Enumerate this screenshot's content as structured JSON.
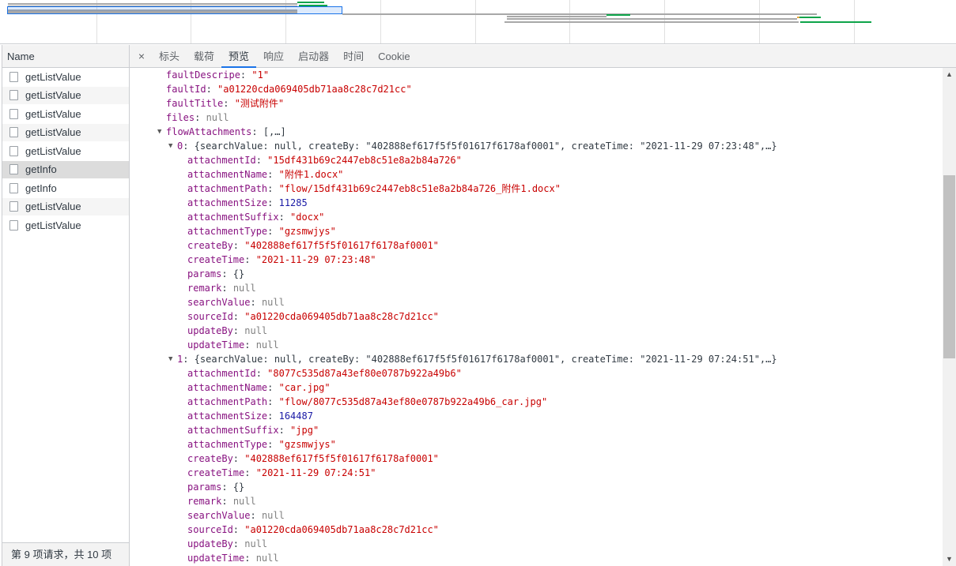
{
  "requests": {
    "header": "Name",
    "items": [
      {
        "name": "getListValue"
      },
      {
        "name": "getListValue"
      },
      {
        "name": "getListValue"
      },
      {
        "name": "getListValue"
      },
      {
        "name": "getListValue"
      },
      {
        "name": "getInfo"
      },
      {
        "name": "getInfo"
      },
      {
        "name": "getListValue"
      },
      {
        "name": "getListValue"
      }
    ],
    "selected_index": 5,
    "status": "第 9 项请求，共 10 项"
  },
  "detail_tabs": {
    "close": "×",
    "tabs": [
      "标头",
      "载荷",
      "预览",
      "响应",
      "启动器",
      "时间",
      "Cookie"
    ],
    "active": "预览"
  },
  "preview": {
    "lines": [
      {
        "indent": 210,
        "arrow": "",
        "parts": [
          [
            "key",
            "faultDescripe"
          ],
          [
            "pun",
            ": "
          ],
          [
            "str",
            "\"1\""
          ]
        ]
      },
      {
        "indent": 210,
        "arrow": "",
        "parts": [
          [
            "key",
            "faultId"
          ],
          [
            "pun",
            ": "
          ],
          [
            "str",
            "\"a01220cda069405db71aa8c28c7d21cc\""
          ]
        ]
      },
      {
        "indent": 210,
        "arrow": "",
        "parts": [
          [
            "key",
            "faultTitle"
          ],
          [
            "pun",
            ": "
          ],
          [
            "str",
            "\"测试附件\""
          ]
        ]
      },
      {
        "indent": 210,
        "arrow": "",
        "parts": [
          [
            "key",
            "files"
          ],
          [
            "pun",
            ": "
          ],
          [
            "nul",
            "null"
          ]
        ]
      },
      {
        "indent": 210,
        "arrow": "▼",
        "parts": [
          [
            "key",
            "flowAttachments"
          ],
          [
            "pun",
            ": [,…]"
          ]
        ]
      },
      {
        "indent": 224,
        "arrow": "▼",
        "parts": [
          [
            "key",
            "0"
          ],
          [
            "pun",
            ": {searchValue: null, createBy: \"402888ef617f5f5f01617f6178af0001\", createTime: \"2021-11-29 07:23:48\",…}"
          ]
        ]
      },
      {
        "indent": 237,
        "arrow": "",
        "parts": [
          [
            "key",
            "attachmentId"
          ],
          [
            "pun",
            ": "
          ],
          [
            "str",
            "\"15df431b69c2447eb8c51e8a2b84a726\""
          ]
        ]
      },
      {
        "indent": 237,
        "arrow": "",
        "parts": [
          [
            "key",
            "attachmentName"
          ],
          [
            "pun",
            ": "
          ],
          [
            "str",
            "\"附件1.docx\""
          ]
        ]
      },
      {
        "indent": 237,
        "arrow": "",
        "parts": [
          [
            "key",
            "attachmentPath"
          ],
          [
            "pun",
            ": "
          ],
          [
            "str",
            "\"flow/15df431b69c2447eb8c51e8a2b84a726_附件1.docx\""
          ]
        ]
      },
      {
        "indent": 237,
        "arrow": "",
        "parts": [
          [
            "key",
            "attachmentSize"
          ],
          [
            "pun",
            ": "
          ],
          [
            "num",
            "11285"
          ]
        ]
      },
      {
        "indent": 237,
        "arrow": "",
        "parts": [
          [
            "key",
            "attachmentSuffix"
          ],
          [
            "pun",
            ": "
          ],
          [
            "str",
            "\"docx\""
          ]
        ]
      },
      {
        "indent": 237,
        "arrow": "",
        "parts": [
          [
            "key",
            "attachmentType"
          ],
          [
            "pun",
            ": "
          ],
          [
            "str",
            "\"gzsmwjys\""
          ]
        ]
      },
      {
        "indent": 237,
        "arrow": "",
        "parts": [
          [
            "key",
            "createBy"
          ],
          [
            "pun",
            ": "
          ],
          [
            "str",
            "\"402888ef617f5f5f01617f6178af0001\""
          ]
        ]
      },
      {
        "indent": 237,
        "arrow": "",
        "parts": [
          [
            "key",
            "createTime"
          ],
          [
            "pun",
            ": "
          ],
          [
            "str",
            "\"2021-11-29 07:23:48\""
          ]
        ]
      },
      {
        "indent": 237,
        "arrow": "",
        "parts": [
          [
            "key",
            "params"
          ],
          [
            "pun",
            ": {}"
          ]
        ]
      },
      {
        "indent": 237,
        "arrow": "",
        "parts": [
          [
            "key",
            "remark"
          ],
          [
            "pun",
            ": "
          ],
          [
            "nul",
            "null"
          ]
        ]
      },
      {
        "indent": 237,
        "arrow": "",
        "parts": [
          [
            "key",
            "searchValue"
          ],
          [
            "pun",
            ": "
          ],
          [
            "nul",
            "null"
          ]
        ]
      },
      {
        "indent": 237,
        "arrow": "",
        "parts": [
          [
            "key",
            "sourceId"
          ],
          [
            "pun",
            ": "
          ],
          [
            "str",
            "\"a01220cda069405db71aa8c28c7d21cc\""
          ]
        ]
      },
      {
        "indent": 237,
        "arrow": "",
        "parts": [
          [
            "key",
            "updateBy"
          ],
          [
            "pun",
            ": "
          ],
          [
            "nul",
            "null"
          ]
        ]
      },
      {
        "indent": 237,
        "arrow": "",
        "parts": [
          [
            "key",
            "updateTime"
          ],
          [
            "pun",
            ": "
          ],
          [
            "nul",
            "null"
          ]
        ]
      },
      {
        "indent": 224,
        "arrow": "▼",
        "parts": [
          [
            "key",
            "1"
          ],
          [
            "pun",
            ": {searchValue: null, createBy: \"402888ef617f5f5f01617f6178af0001\", createTime: \"2021-11-29 07:24:51\",…}"
          ]
        ]
      },
      {
        "indent": 237,
        "arrow": "",
        "parts": [
          [
            "key",
            "attachmentId"
          ],
          [
            "pun",
            ": "
          ],
          [
            "str",
            "\"8077c535d87a43ef80e0787b922a49b6\""
          ]
        ]
      },
      {
        "indent": 237,
        "arrow": "",
        "parts": [
          [
            "key",
            "attachmentName"
          ],
          [
            "pun",
            ": "
          ],
          [
            "str",
            "\"car.jpg\""
          ]
        ]
      },
      {
        "indent": 237,
        "arrow": "",
        "parts": [
          [
            "key",
            "attachmentPath"
          ],
          [
            "pun",
            ": "
          ],
          [
            "str",
            "\"flow/8077c535d87a43ef80e0787b922a49b6_car.jpg\""
          ]
        ]
      },
      {
        "indent": 237,
        "arrow": "",
        "parts": [
          [
            "key",
            "attachmentSize"
          ],
          [
            "pun",
            ": "
          ],
          [
            "num",
            "164487"
          ]
        ]
      },
      {
        "indent": 237,
        "arrow": "",
        "parts": [
          [
            "key",
            "attachmentSuffix"
          ],
          [
            "pun",
            ": "
          ],
          [
            "str",
            "\"jpg\""
          ]
        ]
      },
      {
        "indent": 237,
        "arrow": "",
        "parts": [
          [
            "key",
            "attachmentType"
          ],
          [
            "pun",
            ": "
          ],
          [
            "str",
            "\"gzsmwjys\""
          ]
        ]
      },
      {
        "indent": 237,
        "arrow": "",
        "parts": [
          [
            "key",
            "createBy"
          ],
          [
            "pun",
            ": "
          ],
          [
            "str",
            "\"402888ef617f5f5f01617f6178af0001\""
          ]
        ]
      },
      {
        "indent": 237,
        "arrow": "",
        "parts": [
          [
            "key",
            "createTime"
          ],
          [
            "pun",
            ": "
          ],
          [
            "str",
            "\"2021-11-29 07:24:51\""
          ]
        ]
      },
      {
        "indent": 237,
        "arrow": "",
        "parts": [
          [
            "key",
            "params"
          ],
          [
            "pun",
            ": {}"
          ]
        ]
      },
      {
        "indent": 237,
        "arrow": "",
        "parts": [
          [
            "key",
            "remark"
          ],
          [
            "pun",
            ": "
          ],
          [
            "nul",
            "null"
          ]
        ]
      },
      {
        "indent": 237,
        "arrow": "",
        "parts": [
          [
            "key",
            "searchValue"
          ],
          [
            "pun",
            ": "
          ],
          [
            "nul",
            "null"
          ]
        ]
      },
      {
        "indent": 237,
        "arrow": "",
        "parts": [
          [
            "key",
            "sourceId"
          ],
          [
            "pun",
            ": "
          ],
          [
            "str",
            "\"a01220cda069405db71aa8c28c7d21cc\""
          ]
        ]
      },
      {
        "indent": 237,
        "arrow": "",
        "parts": [
          [
            "key",
            "updateBy"
          ],
          [
            "pun",
            ": "
          ],
          [
            "nul",
            "null"
          ]
        ]
      },
      {
        "indent": 237,
        "arrow": "",
        "parts": [
          [
            "key",
            "updateTime"
          ],
          [
            "pun",
            ": "
          ],
          [
            "nul",
            "null"
          ]
        ]
      }
    ]
  },
  "colors": {
    "key": "#881280",
    "string": "#c80000",
    "number": "#1a1aa6",
    "null": "#808080",
    "accent": "#1a73e8",
    "waterfall_green": "#0ea44a",
    "waterfall_gray": "#a8a8a8"
  },
  "icons": {
    "request": "file-icon",
    "expand": "triangle-down-icon",
    "close": "close-icon",
    "scroll_up": "scroll-up-icon",
    "scroll_down": "scroll-down-icon"
  }
}
